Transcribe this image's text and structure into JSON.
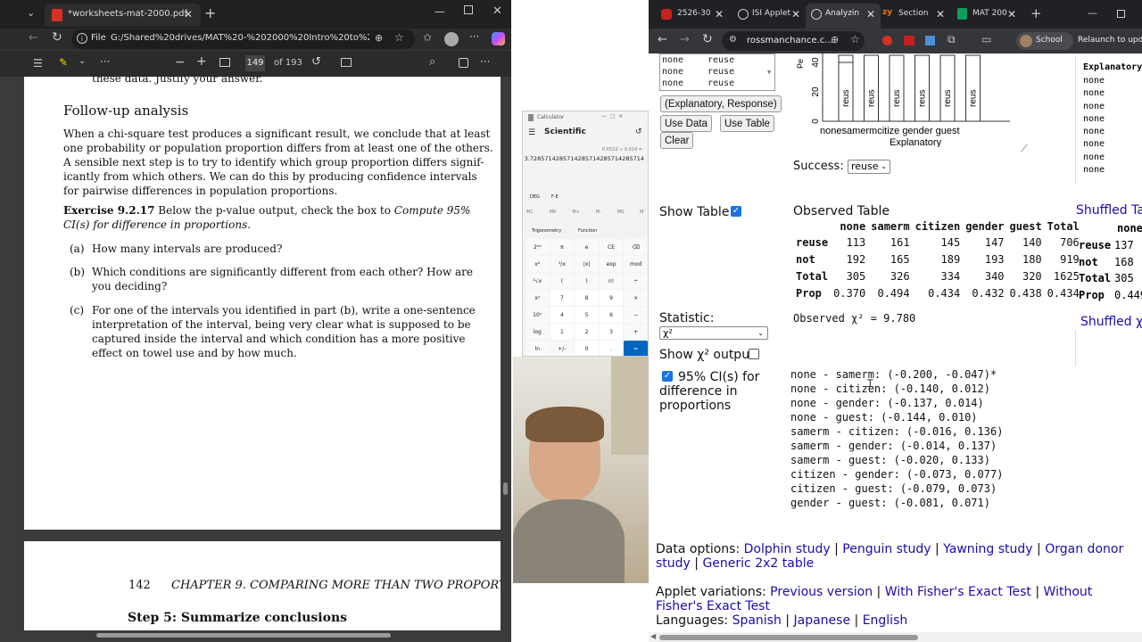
{
  "pdf_window": {
    "tab_title": "*worksheets-mat-2000.pdf",
    "file_label": "File",
    "address": "G:/Shared%20drives/MAT%20-%202000%20Intro%20to%20Stats...",
    "page_current": "149",
    "page_total": "of 193",
    "cut_line": "these data.  Justify your answer.",
    "heading": "Follow-up analysis",
    "para": [
      "When a chi-square test produces a significant result, we conclude that at least",
      "one probability or population proportion differs from at least one of the others.",
      "A sensible next step is to try to identify which group proportion differs signif-",
      "icantly from which others.  We can do this by producing confidence intervals",
      "for pairwise differences in population proportions."
    ],
    "exercise_label": "Exercise 9.2.17",
    "exercise_line1": "Below the p-value output, check the box to",
    "exercise_line1_italic": "Compute 95%",
    "exercise_line2_italic": "CI(s) for difference in proportions.",
    "items": [
      {
        "label": "(a)",
        "lines": [
          "How many intervals are produced?"
        ]
      },
      {
        "label": "(b)",
        "lines": [
          "Which conditions are significantly different from each other?  How are",
          "you deciding?"
        ]
      },
      {
        "label": "(c)",
        "lines": [
          "For one of the intervals you identified in part (b), write a one-sentence",
          "interpretation of the interval, being very clear what is supposed to be",
          "captured inside the interval and which condition has a more positive",
          "effect on towel use and by how much."
        ]
      }
    ],
    "page2_number": "142",
    "page2_header": "CHAPTER 9.  COMPARING MORE THAN TWO PROPORT",
    "page2_heading": "Step 5:  Summarize conclusions"
  },
  "calculator": {
    "title": "Calculator",
    "mode": "Scientific",
    "history": "0.6522 ÷ 0.014 =",
    "display": "3.7285714285714285714285714285714",
    "deg": "DEG",
    "fe": "F-E",
    "memory": [
      "MC",
      "MR",
      "M+",
      "M-",
      "MS",
      "M˅"
    ],
    "trig": "Trigonometry",
    "func": "Function",
    "keys": [
      "2ⁿᵈ",
      "π",
      "e",
      "CE",
      "⌫",
      "x²",
      "¹/x",
      "|x|",
      "exp",
      "mod",
      "²√x",
      "(",
      ")",
      "n!",
      "÷",
      "xʸ",
      "7",
      "8",
      "9",
      "×",
      "10ˣ",
      "4",
      "5",
      "6",
      "−",
      "log",
      "1",
      "2",
      "3",
      "+",
      "ln",
      "+/-",
      "0",
      ".",
      "="
    ]
  },
  "browser": {
    "tabs": [
      "2526-30",
      "ISI Applet",
      "Analyzin",
      "Section",
      "MAT 200"
    ],
    "url": "rossmanchance.c...",
    "profile": "School",
    "relaunch": "Relaunch to update"
  },
  "applet": {
    "data_rows": [
      [
        "none",
        "reuse"
      ],
      [
        "none",
        "reuse"
      ],
      [
        "none",
        "reuse"
      ]
    ],
    "format_button": "(Explanatory, Response)",
    "use_data": "Use Data",
    "use_table": "Use Table",
    "clear": "Clear",
    "success_label": "Success:",
    "success_value": "reuse",
    "show_table": "Show Table",
    "observed_title": "Observed Table",
    "table_headers": [
      "",
      "none",
      "samerm",
      "citizen",
      "gender",
      "guest",
      "Total"
    ],
    "table_rows": [
      [
        "reuse",
        "113",
        "161",
        "145",
        "147",
        "140",
        "706"
      ],
      [
        "not",
        "192",
        "165",
        "189",
        "193",
        "180",
        "919"
      ],
      [
        "Total",
        "305",
        "326",
        "334",
        "340",
        "320",
        "1625"
      ],
      [
        "Prop",
        "0.370",
        "0.494",
        "0.434",
        "0.432",
        "0.438",
        "0.434"
      ]
    ],
    "statistic_label": "Statistic:",
    "statistic_value": "χ²",
    "observed_chi": "Observed χ² = 9.780",
    "show_chi_output": "Show χ² output",
    "ci_label": "95% CI(s) for difference in proportions",
    "ci_lines": [
      "none - samerm: (-0.200, -0.047)*",
      "none - citizen: (-0.140, 0.012)",
      "none - gender: (-0.137, 0.014)",
      "none - guest: (-0.144, 0.010)",
      "samerm - citizen: (-0.016, 0.136)",
      "samerm - gender: (-0.014, 0.137)",
      "samerm - guest: (-0.020, 0.133)",
      "citizen - gender: (-0.073, 0.077)",
      "citizen - guest: (-0.079, 0.073)",
      "gender - guest: (-0.081, 0.071)"
    ],
    "chart": {
      "y_label": "Pe",
      "ticks": [
        "40",
        "20",
        "0"
      ],
      "bar_label": "reus",
      "x_categories": "nonesamermcitize gender guest",
      "x_title": "Explanatory"
    },
    "shuffle_panel": {
      "header": "Explanatory",
      "rows": [
        "none",
        "none",
        "none",
        "none",
        "none",
        "none",
        "none",
        "none"
      ],
      "title": "Shuffled Ta",
      "head_cell": "none",
      "rows_label": [
        [
          "reuse",
          "137"
        ],
        [
          "not",
          "168"
        ],
        [
          "Total",
          "305"
        ],
        [
          "Prop",
          "0.449"
        ]
      ],
      "chi": "Shuffled χ"
    },
    "data_options_label": "Data options:",
    "data_options": [
      "Dolphin study",
      "Penguin study",
      "Yawning study",
      "Organ donor study",
      "Generic 2x2 table"
    ],
    "variations_label": "Applet variations:",
    "variations": [
      "Previous version",
      "With Fisher's Exact Test",
      "Without Fisher's Exact Test"
    ],
    "languages_label": "Languages:",
    "languages": [
      "Spanish",
      "Japanese",
      "English"
    ]
  }
}
